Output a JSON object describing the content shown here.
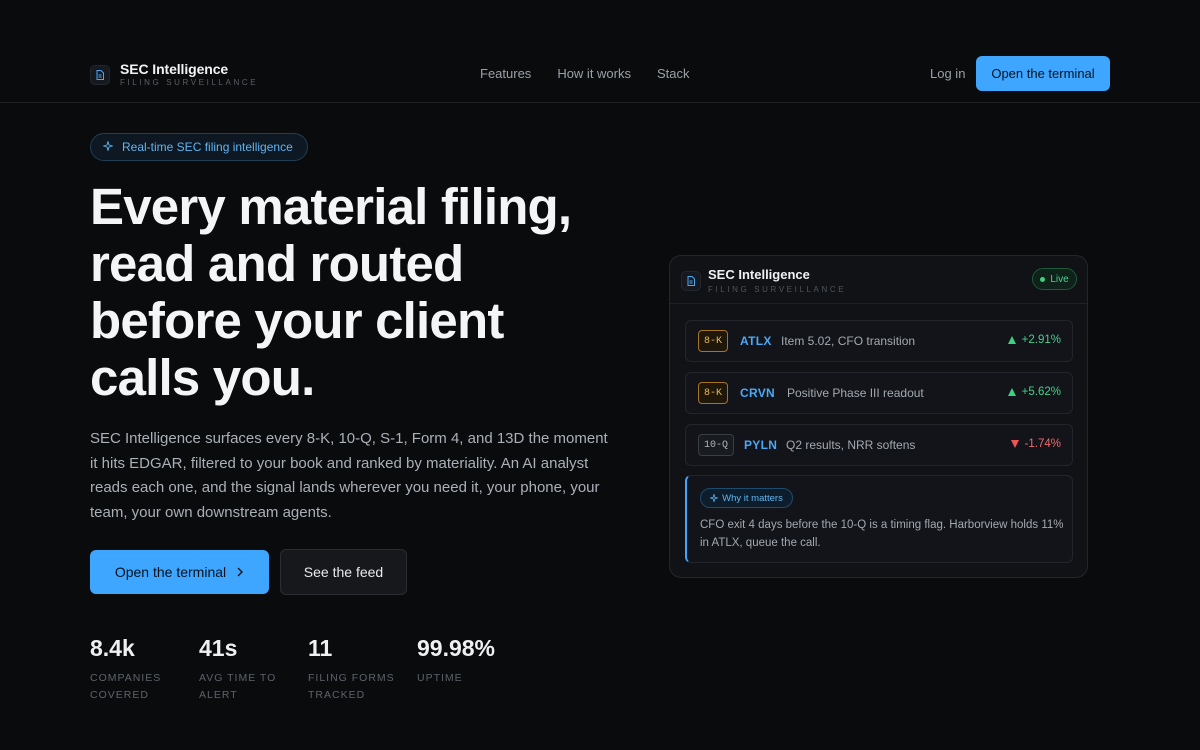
{
  "nav": {
    "brand_title": "SEC Intelligence",
    "brand_subtitle": "FILING SURVEILLANCE",
    "links": [
      "Features",
      "How it works",
      "Stack"
    ],
    "login": "Log in",
    "cta": "Open the terminal"
  },
  "hero": {
    "pill": "Real-time SEC filing intelligence",
    "headline": [
      "Every material filing,",
      "read and routed",
      "before your client",
      "calls you."
    ],
    "description": "SEC Intelligence surfaces every 8-K, 10-Q, S-1, Form 4, and 13D the moment it hits EDGAR, filtered to your book and ranked by materiality. An AI analyst reads each one, and the signal lands wherever you need it, your phone, your team, your own downstream agents.",
    "primary_button": "Open the terminal",
    "secondary_button": "See the feed"
  },
  "stats": [
    {
      "value": "8.4k",
      "label": "COMPANIES COVERED"
    },
    {
      "value": "41s",
      "label": "AVG TIME TO ALERT"
    },
    {
      "value": "11",
      "label": "FILING FORMS TRACKED"
    },
    {
      "value": "99.98%",
      "label": "UPTIME"
    }
  ],
  "card": {
    "title": "SEC Intelligence",
    "subtitle": "FILING SURVEILLANCE",
    "live": "Live",
    "rows": [
      {
        "form": "8-K",
        "ticker": "ATLX",
        "event": "Item 5.02, CFO transition",
        "change": "+2.91%",
        "direction": "up"
      },
      {
        "form": "8-K",
        "ticker": "CRVN",
        "event": "Positive Phase III readout",
        "change": "+5.62%",
        "direction": "up"
      },
      {
        "form": "10-Q",
        "ticker": "PYLN",
        "event": "Q2 results, NRR softens",
        "change": "-1.74%",
        "direction": "down"
      }
    ],
    "why_badge": "Why it matters",
    "why_text": "CFO exit 4 days before the 10-Q is a timing flag. Harborview holds 11% in ATLX, queue the call."
  },
  "colors": {
    "accent": "#3ea6ff",
    "positive": "#3ed07f",
    "negative": "#f05454",
    "form_8k": "#f0b74a",
    "background": "#0a0b0d"
  },
  "icons": {
    "brand": "document-icon",
    "pill": "sparkle-icon",
    "primary_button": "chevron-right-icon",
    "live": "live-dot-icon",
    "why_badge": "sparkle-icon"
  }
}
